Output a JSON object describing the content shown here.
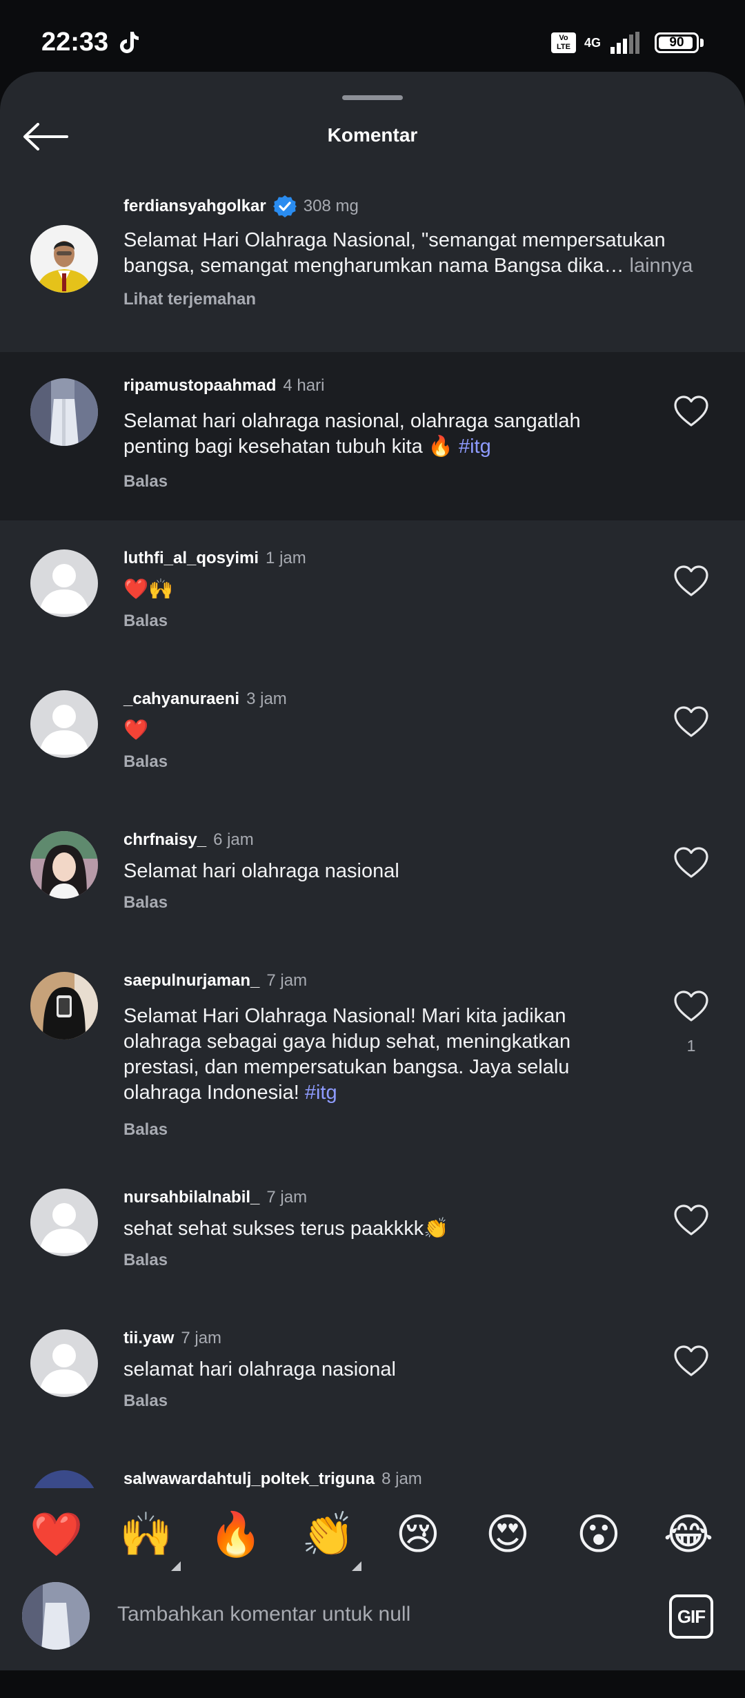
{
  "status_bar": {
    "time": "22:33",
    "volte": "Vo LTE",
    "network": "4G",
    "battery": "90"
  },
  "header": {
    "title": "Komentar"
  },
  "caption": {
    "username": "ferdiansyahgolkar",
    "time": "308 mg",
    "text": "Selamat Hari Olahraga Nasional, \"semangat mempersatukan bangsa, semangat mengharumkan nama Bangsa dika…",
    "more": "lainnya",
    "translate": "Lihat terjemahan"
  },
  "comments": [
    {
      "username": "ripamustopaahmad",
      "time": "4 hari",
      "text": "Selamat hari olahraga nasional, olahraga sangatlah penting bagi kesehatan tubuh kita 🔥",
      "tag": "#itg",
      "reply": "Balas"
    },
    {
      "username": "luthfi_al_qosyimi",
      "time": "1 jam",
      "text": "❤️🙌",
      "reply": "Balas"
    },
    {
      "username": "_cahyanuraeni",
      "time": "3 jam",
      "text": "❤️",
      "reply": "Balas"
    },
    {
      "username": "chrfnaisy_",
      "time": "6 jam",
      "text": "Selamat hari olahraga nasional",
      "reply": "Balas"
    },
    {
      "username": "saepulnurjaman_",
      "time": "7 jam",
      "text": "Selamat Hari Olahraga Nasional! Mari kita jadikan olahraga sebagai gaya hidup sehat, meningkatkan prestasi, dan mempersatukan bangsa. Jaya selalu olahraga Indonesia!",
      "tag": "#itg",
      "reply": "Balas",
      "likes": "1"
    },
    {
      "username": "nursahbilalnabil_",
      "time": "7 jam",
      "text": "sehat sehat sukses terus paakkkk👏",
      "reply": "Balas"
    },
    {
      "username": "tii.yaw",
      "time": "7 jam",
      "text": "selamat hari olahraga nasional",
      "reply": "Balas"
    },
    {
      "username": "salwawardahtulj_poltek_triguna",
      "time": "8 jam"
    }
  ],
  "emoji_bar": [
    "❤️",
    "🙌",
    "🔥",
    "👏",
    "😢",
    "😍",
    "😮",
    "😂"
  ],
  "composer": {
    "placeholder": "Tambahkan komentar untuk null",
    "gif_label": "GIF"
  }
}
